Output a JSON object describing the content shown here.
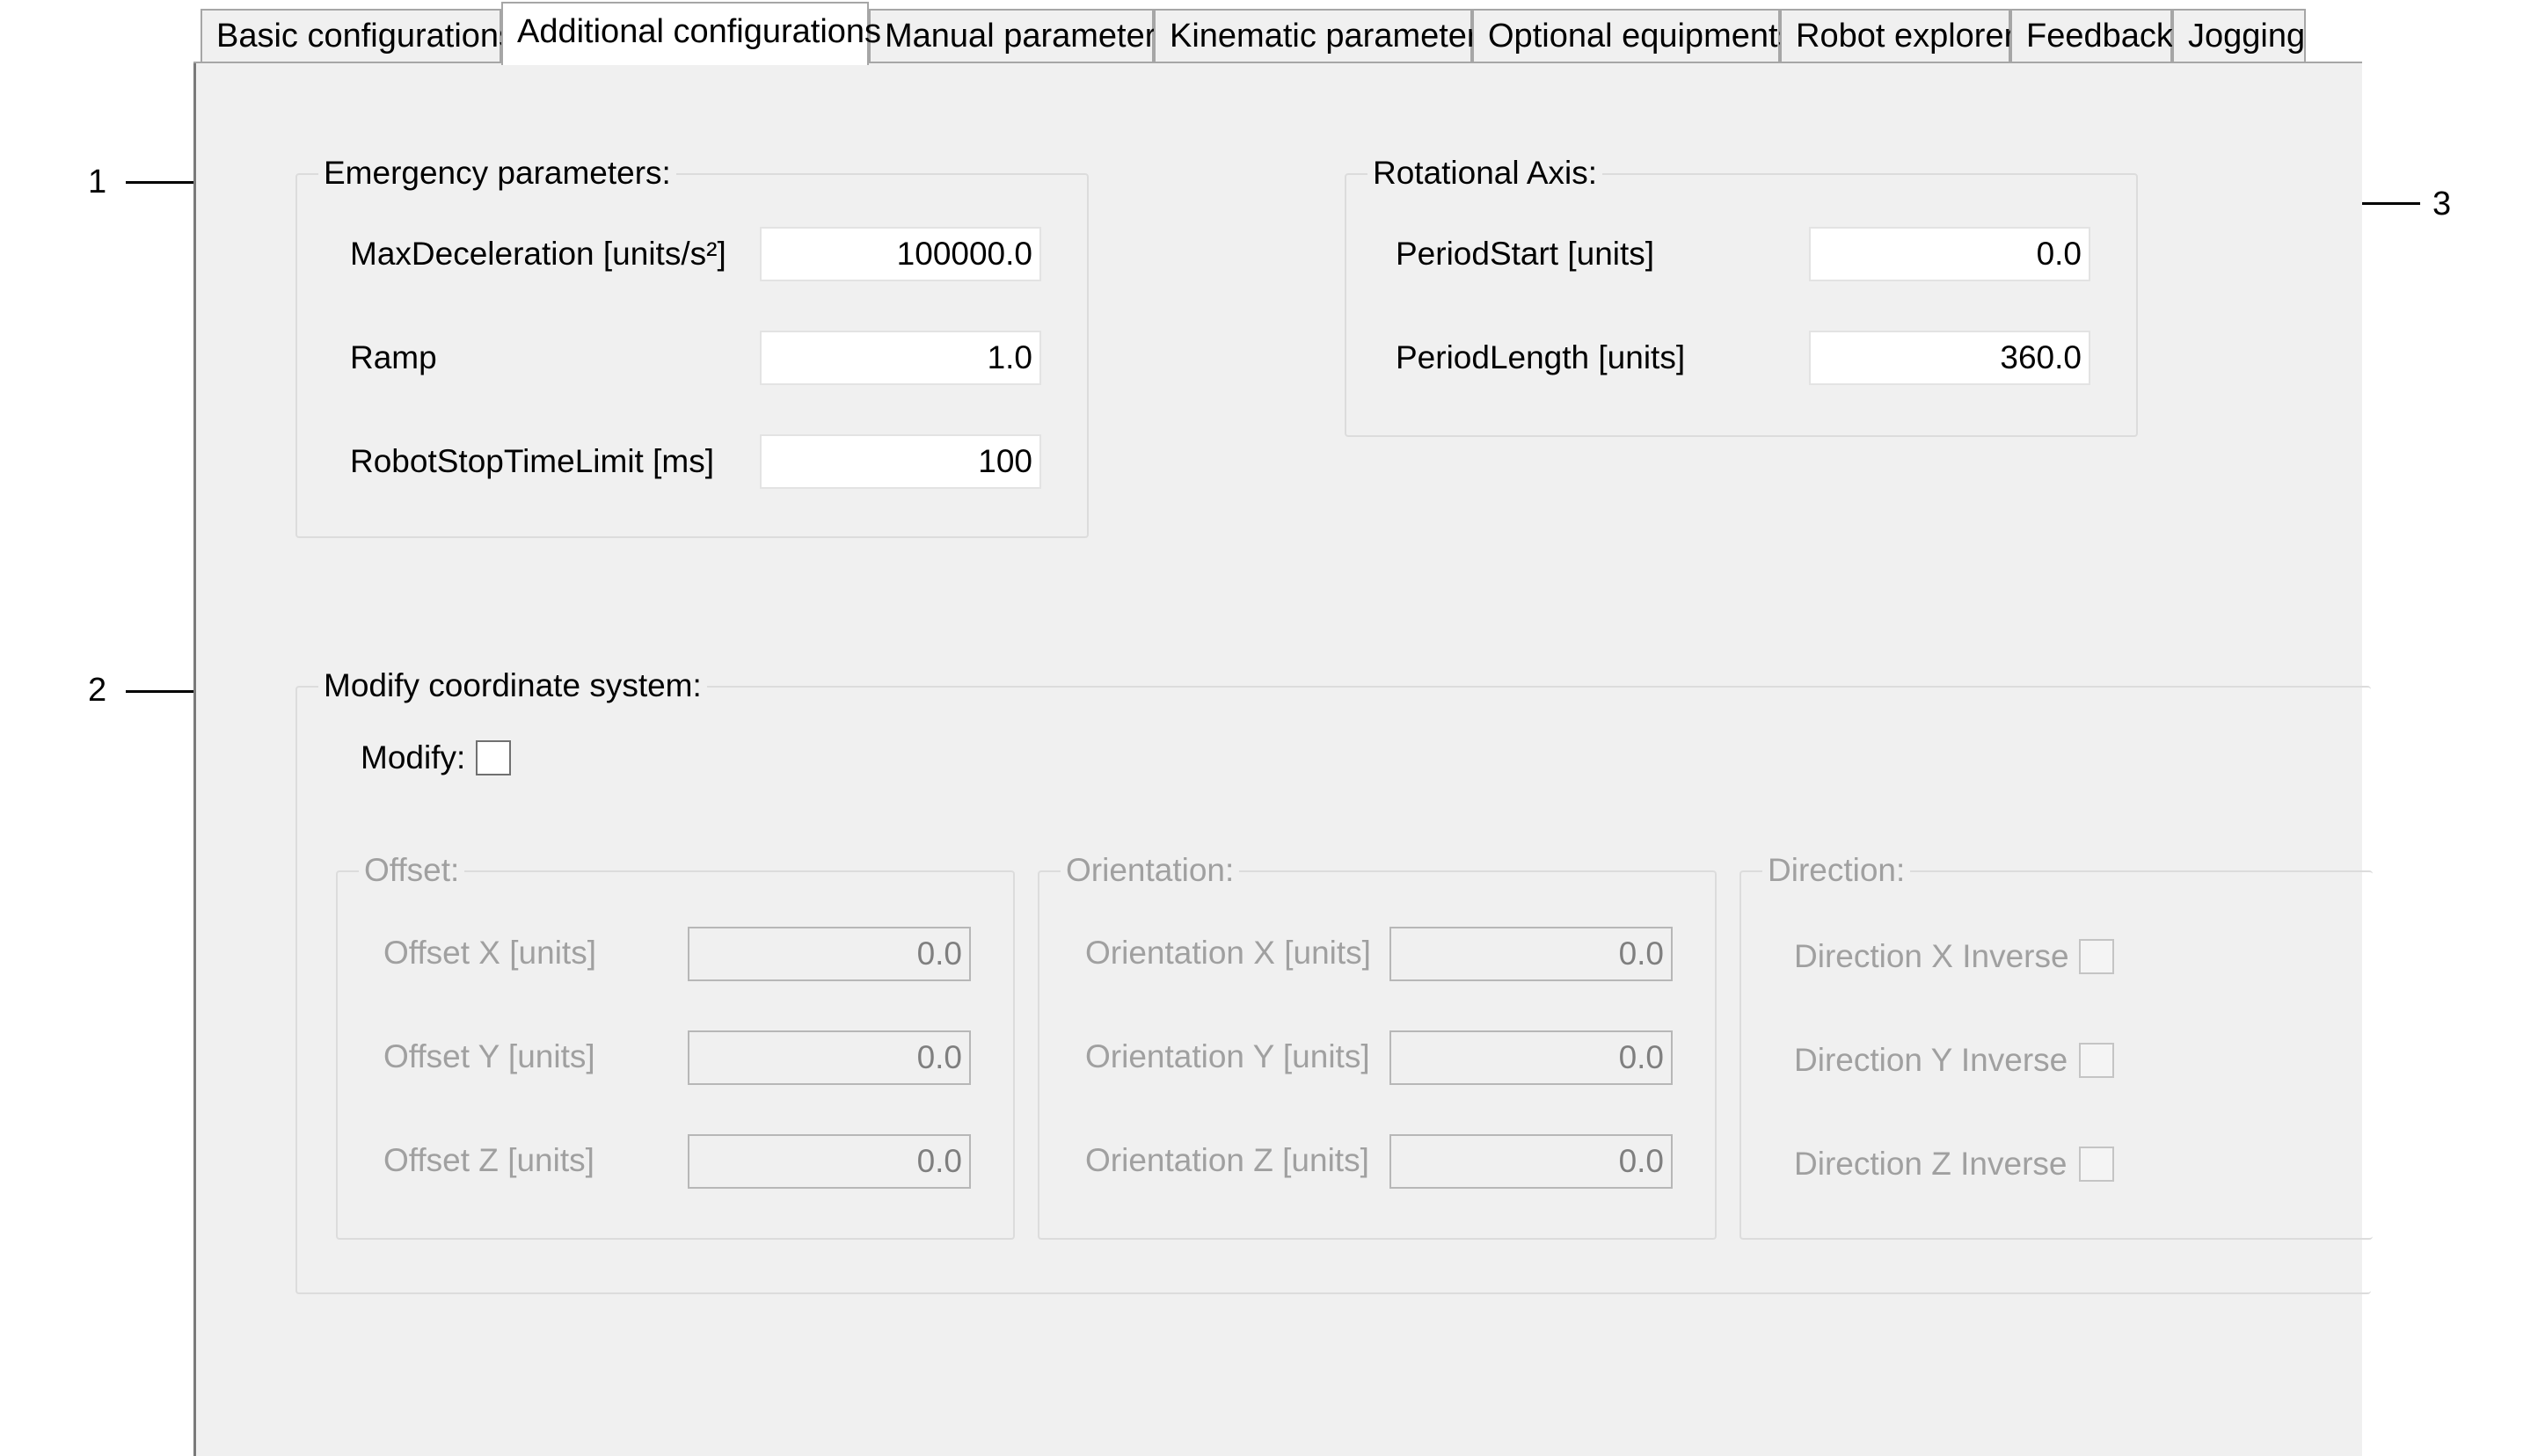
{
  "callouts": [
    "1",
    "2",
    "3"
  ],
  "tabs": [
    {
      "label": "Basic configurations"
    },
    {
      "label": "Additional configurations"
    },
    {
      "label": "Manual parameters"
    },
    {
      "label": "Kinematic parameters"
    },
    {
      "label": "Optional equipments"
    },
    {
      "label": "Robot explorer"
    },
    {
      "label": "Feedback"
    },
    {
      "label": "Jogging"
    }
  ],
  "emergency": {
    "title": "Emergency parameters:",
    "max_decel_label": "MaxDeceleration [units/s²]",
    "max_decel_value": "100000.0",
    "ramp_label": "Ramp",
    "ramp_value": "1.0",
    "stop_time_label": "RobotStopTimeLimit [ms]",
    "stop_time_value": "100"
  },
  "rotational": {
    "title": "Rotational Axis:",
    "period_start_label": "PeriodStart [units]",
    "period_start_value": "0.0",
    "period_length_label": "PeriodLength [units]",
    "period_length_value": "360.0"
  },
  "modify": {
    "title": "Modify coordinate system:",
    "modify_label": "Modify:",
    "modify_checked": false,
    "offset": {
      "title": "Offset:",
      "x_label": "Offset X [units]",
      "x_value": "0.0",
      "y_label": "Offset Y [units]",
      "y_value": "0.0",
      "z_label": "Offset Z [units]",
      "z_value": "0.0"
    },
    "orientation": {
      "title": "Orientation:",
      "x_label": "Orientation X [units]",
      "x_value": "0.0",
      "y_label": "Orientation Y [units]",
      "y_value": "0.0",
      "z_label": "Orientation Z [units]",
      "z_value": "0.0"
    },
    "direction": {
      "title": "Direction:",
      "x_label": "Direction X Inverse",
      "y_label": "Direction Y Inverse",
      "z_label": "Direction Z Inverse"
    }
  }
}
